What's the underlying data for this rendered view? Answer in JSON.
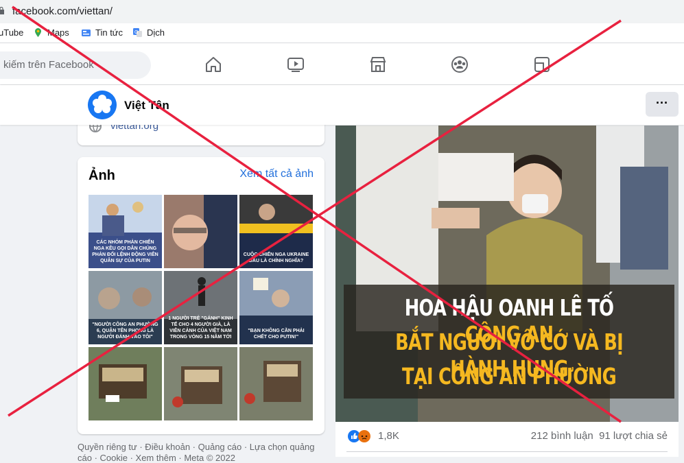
{
  "browser": {
    "url": "facebook.com/viettan/",
    "bookmarks": [
      {
        "label": "uTube",
        "icon": "youtube-icon"
      },
      {
        "label": "Maps",
        "icon": "maps-icon"
      },
      {
        "label": "Tin tức",
        "icon": "news-icon"
      },
      {
        "label": "Dịch",
        "icon": "translate-icon"
      }
    ]
  },
  "fb": {
    "search_placeholder": "kiếm trên Facebook",
    "nav": [
      "home-icon",
      "watch-icon",
      "marketplace-icon",
      "groups-icon",
      "gaming-icon"
    ]
  },
  "page": {
    "name": "Việt Tân",
    "website": "viettan.org",
    "more_label": "···"
  },
  "photos": {
    "title": "Ảnh",
    "see_all": "Xem tất cả ảnh",
    "tiles": [
      {
        "caption": "CÁC NHÓM PHẢN CHIẾN NGA KÊU GỌI DÂN CHÚNG PHẢN ĐỐI LỆNH ĐỘNG VIÊN QUÂN SỰ CỦA PUTIN",
        "bg": "#3b4f8a"
      },
      {
        "caption": "",
        "bg": "#b98f7a"
      },
      {
        "caption": "CUỘC CHIẾN NGA UKRAINE ĐẦU LÀ CHÍNH NGHĨA?",
        "bg": "#2d3a5c"
      },
      {
        "caption": "\"NGƯỜI CÔNG AN PHƯỜNG 6, QUẬN TÊN PHONG LÀ NGƯỜI ĐÁNH VÀO TÔI\"",
        "bg": "#5e6d7a"
      },
      {
        "caption": "1 NGƯỜI TRẺ \"GÁNH\" KINH TẾ CHO 4 NGƯỜI GIÀ, LÀ VIỄN CẢNH CỦA VIỆT NAM TRONG VÒNG 15 NĂM TỚI",
        "bg": "#555a5e"
      },
      {
        "caption": "\"BẠN KHÔNG CẦN PHẢI CHẾT CHO PUTIN!\"",
        "bg": "#3e5577"
      },
      {
        "caption": "",
        "bg": "#7d8a6b"
      },
      {
        "caption": "",
        "bg": "#8b8f7e"
      },
      {
        "caption": "",
        "bg": "#858874"
      }
    ]
  },
  "footer": {
    "line1": "Quyền riêng tư · Điều khoản · Quảng cáo · Lựa chọn quảng",
    "line2": "cáo · Cookie · Xem thêm · Meta © 2022"
  },
  "post": {
    "headline": [
      [
        {
          "t": "HOA HẬU OANH LÊ TỐ ",
          "c": "w"
        },
        {
          "t": "CÔNG AN",
          "c": "y"
        }
      ],
      [
        {
          "t": "BẮT NGƯỜI VÔ CỚ VÀ BỊ ",
          "c": "y"
        },
        {
          "t": "HÀNH HUNG",
          "c": "y"
        }
      ],
      [
        {
          "t": "TẠI CÔNG AN PHƯỜNG",
          "c": "y"
        }
      ]
    ],
    "reactions_count": "1,8K",
    "comments": "212 bình luận",
    "shares": "91 lượt chia sẻ"
  },
  "colors": {
    "fb_blue": "#1877f2",
    "cross": "#e8213f",
    "accent_yellow": "#f5b820"
  }
}
